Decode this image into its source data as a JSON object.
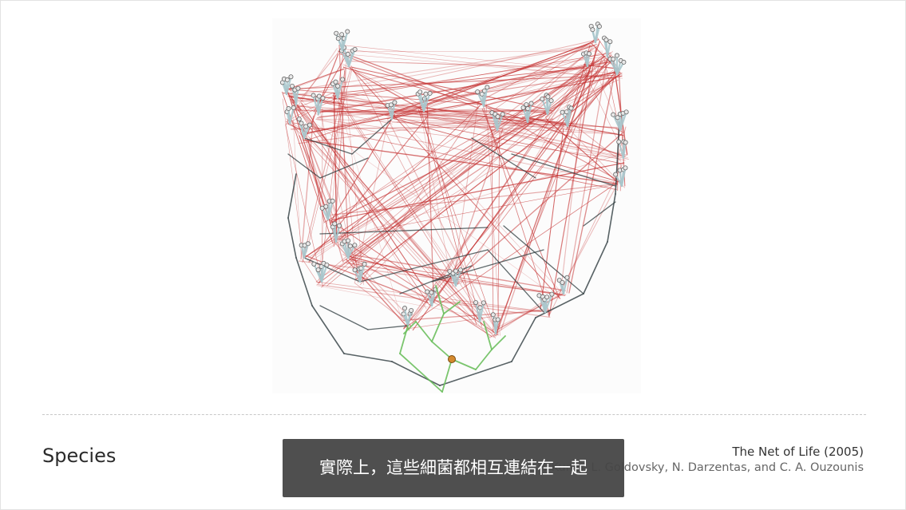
{
  "slide": {
    "section_title": "Species",
    "caption_title": "The Net of Life (2005)",
    "caption_authors": "V. Kunin, L. Goldovsky, N. Darzentas, and C. A. Ouzounis"
  },
  "video": {
    "subtitle": "實際上，這些細菌都相互連結在一起"
  },
  "figure": {
    "description_name": "net-of-life-network",
    "colors": {
      "tree_gray": "#2e3b3e",
      "tree_light": "#a9c6cc",
      "links_red": "#c43030",
      "green_tree": "#6bbf5d",
      "highlight_node": "#d4892e"
    }
  }
}
